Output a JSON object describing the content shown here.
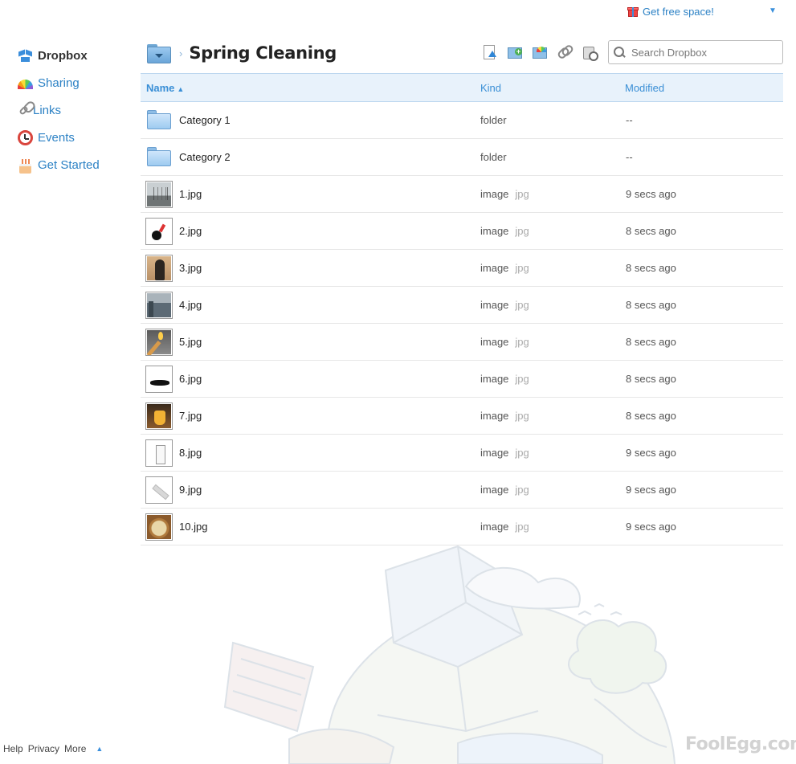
{
  "top": {
    "promo_label": "Get free space!",
    "promo_icon": "gift-icon",
    "account_menu_icon": "triangle-down-icon"
  },
  "sidebar": {
    "items": [
      {
        "label": "Dropbox",
        "icon": "dropbox-icon",
        "active": true
      },
      {
        "label": "Sharing",
        "icon": "rainbow-icon",
        "active": false
      },
      {
        "label": "Links",
        "icon": "link-icon",
        "active": false
      },
      {
        "label": "Events",
        "icon": "clock-icon",
        "active": false
      },
      {
        "label": "Get Started",
        "icon": "cake-icon",
        "active": false
      }
    ]
  },
  "header": {
    "breadcrumb_separator": "›",
    "title": "Spring Cleaning"
  },
  "toolbar": {
    "buttons": [
      "upload-icon",
      "new-folder-icon",
      "share-folder-icon",
      "get-link-icon",
      "show-deleted-icon"
    ]
  },
  "search": {
    "placeholder": "Search Dropbox",
    "value": ""
  },
  "table": {
    "columns": {
      "name": "Name",
      "name_sort": "▲",
      "kind": "Kind",
      "modified": "Modified"
    },
    "rows": [
      {
        "name": "Category 1",
        "kind": "folder",
        "ext": "",
        "modified": "--",
        "type": "folder"
      },
      {
        "name": "Category 2",
        "kind": "folder",
        "ext": "",
        "modified": "--",
        "type": "folder"
      },
      {
        "name": "1.jpg",
        "kind": "image",
        "ext": "jpg",
        "modified": "9 secs ago",
        "type": "image"
      },
      {
        "name": "2.jpg",
        "kind": "image",
        "ext": "jpg",
        "modified": "8 secs ago",
        "type": "image"
      },
      {
        "name": "3.jpg",
        "kind": "image",
        "ext": "jpg",
        "modified": "8 secs ago",
        "type": "image"
      },
      {
        "name": "4.jpg",
        "kind": "image",
        "ext": "jpg",
        "modified": "8 secs ago",
        "type": "image"
      },
      {
        "name": "5.jpg",
        "kind": "image",
        "ext": "jpg",
        "modified": "8 secs ago",
        "type": "image"
      },
      {
        "name": "6.jpg",
        "kind": "image",
        "ext": "jpg",
        "modified": "8 secs ago",
        "type": "image"
      },
      {
        "name": "7.jpg",
        "kind": "image",
        "ext": "jpg",
        "modified": "8 secs ago",
        "type": "image"
      },
      {
        "name": "8.jpg",
        "kind": "image",
        "ext": "jpg",
        "modified": "9 secs ago",
        "type": "image"
      },
      {
        "name": "9.jpg",
        "kind": "image",
        "ext": "jpg",
        "modified": "9 secs ago",
        "type": "image"
      },
      {
        "name": "10.jpg",
        "kind": "image",
        "ext": "jpg",
        "modified": "9 secs ago",
        "type": "image"
      }
    ]
  },
  "footer": {
    "links": [
      "Help",
      "Privacy",
      "More"
    ],
    "more_arrow": "▲"
  },
  "watermark": "FoolEgg.com",
  "colors": {
    "link": "#2d82c5",
    "header_bg": "#e8f2fb",
    "header_text": "#3a8fd6"
  }
}
